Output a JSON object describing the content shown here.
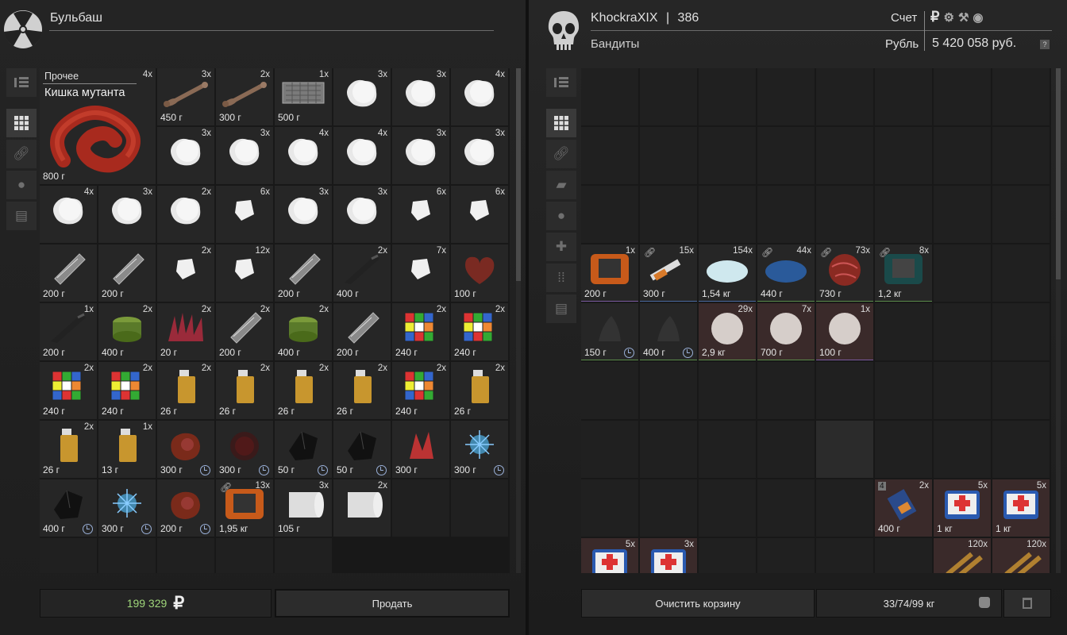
{
  "left": {
    "name": "Бульбаш",
    "money": "199 329",
    "sell_label": "Продать",
    "featured": {
      "category": "Прочее",
      "title": "Кишка мутанта",
      "count": "4x",
      "weight": "800 г"
    },
    "items": [
      {
        "count": "3x",
        "weight": "450 г",
        "art": "bone"
      },
      {
        "count": "2x",
        "weight": "300 г",
        "art": "bone"
      },
      {
        "count": "1x",
        "weight": "500 г",
        "art": "case"
      },
      {
        "count": "3x",
        "weight": "",
        "art": "rock"
      },
      {
        "count": "3x",
        "weight": "",
        "art": "rock"
      },
      {
        "count": "4x",
        "weight": "",
        "art": "rock"
      },
      {
        "count": "3x",
        "weight": "",
        "art": "rock"
      },
      {
        "count": "3x",
        "weight": "",
        "art": "rock"
      },
      {
        "count": "4x",
        "weight": "",
        "art": "rock"
      },
      {
        "count": "4x",
        "weight": "",
        "art": "rock"
      },
      {
        "count": "3x",
        "weight": "",
        "art": "rock"
      },
      {
        "count": "3x",
        "weight": "",
        "art": "rock"
      },
      {
        "count": "4x",
        "weight": "",
        "art": "rock"
      },
      {
        "count": "3x",
        "weight": "",
        "art": "rock"
      },
      {
        "count": "2x",
        "weight": "",
        "art": "rock"
      },
      {
        "count": "6x",
        "weight": "",
        "art": "chip"
      },
      {
        "count": "3x",
        "weight": "",
        "art": "rock"
      },
      {
        "count": "3x",
        "weight": "",
        "art": "rock"
      },
      {
        "count": "6x",
        "weight": "",
        "art": "chip"
      },
      {
        "count": "6x",
        "weight": "",
        "art": "chip"
      },
      {
        "count": "",
        "weight": "200 г",
        "art": "tool"
      },
      {
        "count": "",
        "weight": "200 г",
        "art": "tool"
      },
      {
        "count": "2x",
        "weight": "",
        "art": "chip"
      },
      {
        "count": "12x",
        "weight": "",
        "art": "chip"
      },
      {
        "count": "",
        "weight": "200 г",
        "art": "tool"
      },
      {
        "count": "2x",
        "weight": "400 г",
        "art": "knife"
      },
      {
        "count": "7x",
        "weight": "",
        "art": "chip"
      },
      {
        "count": "",
        "weight": "100 г",
        "art": "heart"
      },
      {
        "count": "1x",
        "weight": "200 г",
        "art": "knife"
      },
      {
        "count": "2x",
        "weight": "400 г",
        "art": "can"
      },
      {
        "count": "2x",
        "weight": "20 г",
        "art": "spike"
      },
      {
        "count": "2x",
        "weight": "200 г",
        "art": "tool"
      },
      {
        "count": "2x",
        "weight": "400 г",
        "art": "can"
      },
      {
        "count": "",
        "weight": "200 г",
        "art": "tool"
      },
      {
        "count": "2x",
        "weight": "240 г",
        "art": "cube"
      },
      {
        "count": "2x",
        "weight": "240 г",
        "art": "cube"
      },
      {
        "count": "2x",
        "weight": "240 г",
        "art": "cube"
      },
      {
        "count": "2x",
        "weight": "240 г",
        "art": "cube"
      },
      {
        "count": "2x",
        "weight": "26 г",
        "art": "lighter"
      },
      {
        "count": "2x",
        "weight": "26 г",
        "art": "lighter"
      },
      {
        "count": "2x",
        "weight": "26 г",
        "art": "lighter"
      },
      {
        "count": "2x",
        "weight": "26 г",
        "art": "lighter"
      },
      {
        "count": "2x",
        "weight": "240 г",
        "art": "cube"
      },
      {
        "count": "2x",
        "weight": "26 г",
        "art": "lighter"
      },
      {
        "count": "2x",
        "weight": "26 г",
        "art": "lighter"
      },
      {
        "count": "1x",
        "weight": "13 г",
        "art": "lighter"
      },
      {
        "count": "",
        "weight": "300 г",
        "art": "meat",
        "clock": true
      },
      {
        "count": "",
        "weight": "300 г",
        "art": "fur",
        "clock": true
      },
      {
        "count": "",
        "weight": "50 г",
        "art": "crystal",
        "clock": true
      },
      {
        "count": "",
        "weight": "50 г",
        "art": "crystal",
        "clock": true
      },
      {
        "count": "",
        "weight": "300 г",
        "art": "redcr"
      },
      {
        "count": "",
        "weight": "300 г",
        "art": "blue",
        "clock": true
      },
      {
        "count": "",
        "weight": "400 г",
        "art": "crystal",
        "clock": true
      },
      {
        "count": "",
        "weight": "300 г",
        "art": "blue",
        "clock": true
      },
      {
        "count": "",
        "weight": "200 г",
        "art": "meat",
        "clock": true
      },
      {
        "count": "13x",
        "weight": "1,95 кг",
        "art": "device",
        "link": true
      },
      {
        "count": "3x",
        "weight": "105 г",
        "art": "paper"
      },
      {
        "count": "2x",
        "weight": "",
        "art": "paper"
      }
    ]
  },
  "right": {
    "trader": "KhockraXIX",
    "sep": "|",
    "level": "386",
    "faction": "Бандиты",
    "account_label": "Счет",
    "currency_label": "Рубль",
    "balance": "5 420 058 руб.",
    "help": "?",
    "clear_label": "Очистить корзину",
    "weight": "33/74/99 кг",
    "items": [
      {
        "pos": 24,
        "count": "1x",
        "weight": "200 г",
        "art": "device",
        "q": "p"
      },
      {
        "pos": 25,
        "count": "15x",
        "weight": "300 г",
        "art": "syringe",
        "link": true,
        "q": "bl"
      },
      {
        "pos": 26,
        "count": "154x",
        "weight": "1,54 кг",
        "art": "powderw",
        "q": "bl"
      },
      {
        "pos": 27,
        "count": "44x",
        "weight": "440 г",
        "art": "powderb",
        "link": true,
        "q": "g"
      },
      {
        "pos": 28,
        "count": "73x",
        "weight": "730 г",
        "art": "ball",
        "link": true,
        "q": "g"
      },
      {
        "pos": 29,
        "count": "8x",
        "weight": "1,2 кг",
        "art": "devicet",
        "link": true,
        "q": "g"
      },
      {
        "pos": 32,
        "count": "",
        "weight": "150 г",
        "art": "ash",
        "clock": true,
        "q": "g"
      },
      {
        "pos": 33,
        "count": "",
        "weight": "400 г",
        "art": "ash",
        "clock": true,
        "q": "g"
      },
      {
        "pos": 34,
        "count": "29x",
        "weight": "2,9 кг",
        "art": "cloud",
        "q": "g",
        "red": true
      },
      {
        "pos": 35,
        "count": "7x",
        "weight": "700 г",
        "art": "cloud",
        "q": "g",
        "red": true
      },
      {
        "pos": 36,
        "count": "1x",
        "weight": "100 г",
        "art": "cloud",
        "q": "p",
        "red": true
      },
      {
        "pos": 61,
        "count": "2x",
        "weight": "400 г",
        "art": "bat",
        "qa": "4",
        "red": true
      },
      {
        "pos": 62,
        "count": "5x",
        "weight": "1 кг",
        "art": "medkit",
        "red": true
      },
      {
        "pos": 63,
        "count": "5x",
        "weight": "1 кг",
        "art": "medkit",
        "red": true
      },
      {
        "pos": 64,
        "count": "5x",
        "weight": "",
        "art": "medkit",
        "red": true
      },
      {
        "pos": 65,
        "count": "3x",
        "weight": "",
        "art": "medkit",
        "red": true
      },
      {
        "pos": 70,
        "count": "120x",
        "weight": "",
        "art": "ammo",
        "red": true
      },
      {
        "pos": 71,
        "count": "120x",
        "weight": "",
        "art": "ammo",
        "red": true
      }
    ],
    "dark_cells": [
      52
    ]
  },
  "colors": {
    "money": "#9fd67a",
    "bg": "#1f1f1f"
  }
}
